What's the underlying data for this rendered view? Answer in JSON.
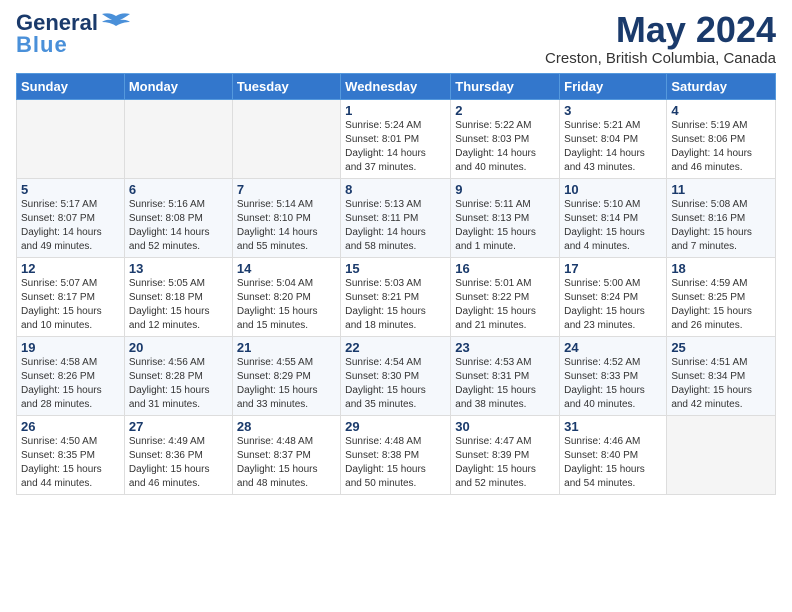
{
  "header": {
    "logo_general": "General",
    "logo_blue": "Blue",
    "month_title": "May 2024",
    "location": "Creston, British Columbia, Canada"
  },
  "days_of_week": [
    "Sunday",
    "Monday",
    "Tuesday",
    "Wednesday",
    "Thursday",
    "Friday",
    "Saturday"
  ],
  "weeks": [
    [
      {
        "day": "",
        "info": ""
      },
      {
        "day": "",
        "info": ""
      },
      {
        "day": "",
        "info": ""
      },
      {
        "day": "1",
        "info": "Sunrise: 5:24 AM\nSunset: 8:01 PM\nDaylight: 14 hours\nand 37 minutes."
      },
      {
        "day": "2",
        "info": "Sunrise: 5:22 AM\nSunset: 8:03 PM\nDaylight: 14 hours\nand 40 minutes."
      },
      {
        "day": "3",
        "info": "Sunrise: 5:21 AM\nSunset: 8:04 PM\nDaylight: 14 hours\nand 43 minutes."
      },
      {
        "day": "4",
        "info": "Sunrise: 5:19 AM\nSunset: 8:06 PM\nDaylight: 14 hours\nand 46 minutes."
      }
    ],
    [
      {
        "day": "5",
        "info": "Sunrise: 5:17 AM\nSunset: 8:07 PM\nDaylight: 14 hours\nand 49 minutes."
      },
      {
        "day": "6",
        "info": "Sunrise: 5:16 AM\nSunset: 8:08 PM\nDaylight: 14 hours\nand 52 minutes."
      },
      {
        "day": "7",
        "info": "Sunrise: 5:14 AM\nSunset: 8:10 PM\nDaylight: 14 hours\nand 55 minutes."
      },
      {
        "day": "8",
        "info": "Sunrise: 5:13 AM\nSunset: 8:11 PM\nDaylight: 14 hours\nand 58 minutes."
      },
      {
        "day": "9",
        "info": "Sunrise: 5:11 AM\nSunset: 8:13 PM\nDaylight: 15 hours\nand 1 minute."
      },
      {
        "day": "10",
        "info": "Sunrise: 5:10 AM\nSunset: 8:14 PM\nDaylight: 15 hours\nand 4 minutes."
      },
      {
        "day": "11",
        "info": "Sunrise: 5:08 AM\nSunset: 8:16 PM\nDaylight: 15 hours\nand 7 minutes."
      }
    ],
    [
      {
        "day": "12",
        "info": "Sunrise: 5:07 AM\nSunset: 8:17 PM\nDaylight: 15 hours\nand 10 minutes."
      },
      {
        "day": "13",
        "info": "Sunrise: 5:05 AM\nSunset: 8:18 PM\nDaylight: 15 hours\nand 12 minutes."
      },
      {
        "day": "14",
        "info": "Sunrise: 5:04 AM\nSunset: 8:20 PM\nDaylight: 15 hours\nand 15 minutes."
      },
      {
        "day": "15",
        "info": "Sunrise: 5:03 AM\nSunset: 8:21 PM\nDaylight: 15 hours\nand 18 minutes."
      },
      {
        "day": "16",
        "info": "Sunrise: 5:01 AM\nSunset: 8:22 PM\nDaylight: 15 hours\nand 21 minutes."
      },
      {
        "day": "17",
        "info": "Sunrise: 5:00 AM\nSunset: 8:24 PM\nDaylight: 15 hours\nand 23 minutes."
      },
      {
        "day": "18",
        "info": "Sunrise: 4:59 AM\nSunset: 8:25 PM\nDaylight: 15 hours\nand 26 minutes."
      }
    ],
    [
      {
        "day": "19",
        "info": "Sunrise: 4:58 AM\nSunset: 8:26 PM\nDaylight: 15 hours\nand 28 minutes."
      },
      {
        "day": "20",
        "info": "Sunrise: 4:56 AM\nSunset: 8:28 PM\nDaylight: 15 hours\nand 31 minutes."
      },
      {
        "day": "21",
        "info": "Sunrise: 4:55 AM\nSunset: 8:29 PM\nDaylight: 15 hours\nand 33 minutes."
      },
      {
        "day": "22",
        "info": "Sunrise: 4:54 AM\nSunset: 8:30 PM\nDaylight: 15 hours\nand 35 minutes."
      },
      {
        "day": "23",
        "info": "Sunrise: 4:53 AM\nSunset: 8:31 PM\nDaylight: 15 hours\nand 38 minutes."
      },
      {
        "day": "24",
        "info": "Sunrise: 4:52 AM\nSunset: 8:33 PM\nDaylight: 15 hours\nand 40 minutes."
      },
      {
        "day": "25",
        "info": "Sunrise: 4:51 AM\nSunset: 8:34 PM\nDaylight: 15 hours\nand 42 minutes."
      }
    ],
    [
      {
        "day": "26",
        "info": "Sunrise: 4:50 AM\nSunset: 8:35 PM\nDaylight: 15 hours\nand 44 minutes."
      },
      {
        "day": "27",
        "info": "Sunrise: 4:49 AM\nSunset: 8:36 PM\nDaylight: 15 hours\nand 46 minutes."
      },
      {
        "day": "28",
        "info": "Sunrise: 4:48 AM\nSunset: 8:37 PM\nDaylight: 15 hours\nand 48 minutes."
      },
      {
        "day": "29",
        "info": "Sunrise: 4:48 AM\nSunset: 8:38 PM\nDaylight: 15 hours\nand 50 minutes."
      },
      {
        "day": "30",
        "info": "Sunrise: 4:47 AM\nSunset: 8:39 PM\nDaylight: 15 hours\nand 52 minutes."
      },
      {
        "day": "31",
        "info": "Sunrise: 4:46 AM\nSunset: 8:40 PM\nDaylight: 15 hours\nand 54 minutes."
      },
      {
        "day": "",
        "info": ""
      }
    ]
  ]
}
